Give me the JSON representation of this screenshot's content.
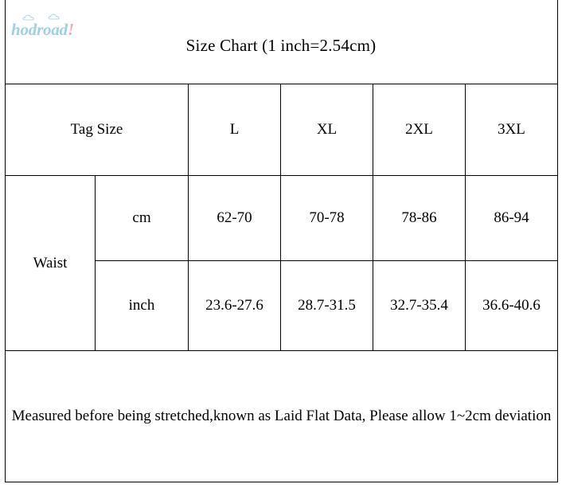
{
  "brand": {
    "name": "hodroad",
    "exclamation": "!",
    "color": "#9ecfe8",
    "accent_color": "#f0aabb",
    "cloud_icon": "cloud-icon"
  },
  "title": "Size Chart (1 inch=2.54cm)",
  "table": {
    "header": {
      "label": "Tag Size",
      "sizes": [
        "L",
        "XL",
        "2XL",
        "3XL"
      ]
    },
    "measurement_label": "Waist",
    "rows": [
      {
        "unit": "cm",
        "values": [
          "62-70",
          "70-78",
          "78-86",
          "86-94"
        ]
      },
      {
        "unit": "inch",
        "values": [
          "23.6-27.6",
          "28.7-31.5",
          "32.7-35.4",
          "36.6-40.6"
        ]
      }
    ],
    "note": "Measured before being stretched,known as Laid Flat Data, Please allow 1~2cm deviation"
  }
}
